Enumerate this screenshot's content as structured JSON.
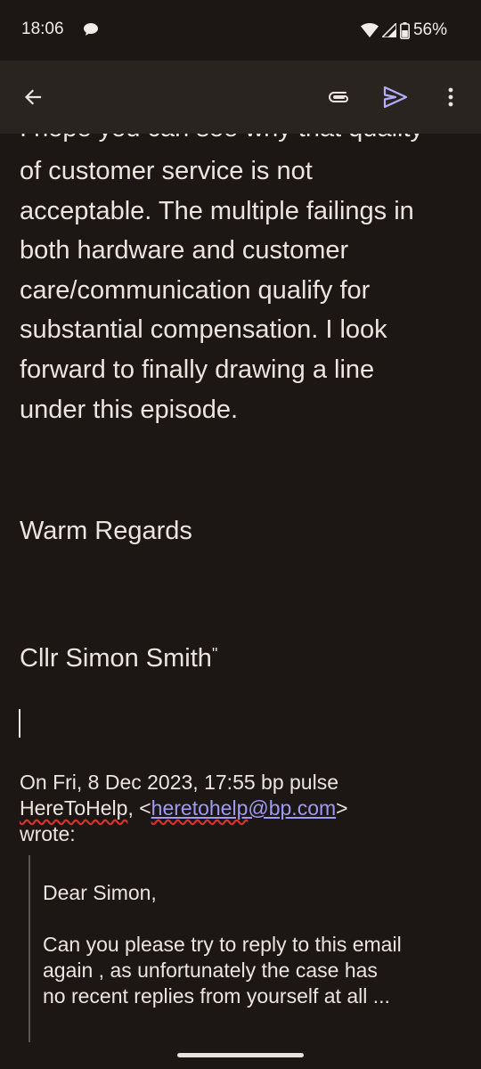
{
  "status_bar": {
    "time": "18:06",
    "battery_percent": "56%",
    "icons": [
      "chat-bubble-icon",
      "wifi-icon",
      "signal-icon",
      "battery-icon"
    ]
  },
  "app_bar": {
    "icons": [
      "back-arrow-icon",
      "attach-icon",
      "send-icon",
      "more-vert-icon"
    ],
    "accent_color": "#b3aefc"
  },
  "body": {
    "clipped_top_line": "I hope you can see why that quality",
    "paragraph_lines": [
      "of customer service is not",
      "acceptable. The multiple failings in",
      "both hardware and customer",
      "care/communication qualify for",
      "substantial compensation. I look",
      "forward to finally drawing a line",
      "under this episode."
    ],
    "regards": "Warm Regards",
    "signature_name": "Cllr Simon Smith",
    "signature_quote_mark": "\""
  },
  "quoted": {
    "header_line1": "On Fri, 8 Dec 2023, 17:55 bp pulse",
    "header_sender": "HereToHelp",
    "header_open": ", <",
    "header_email_user": "heretohelp",
    "header_email_domain": "@bp.com",
    "header_close": ">",
    "header_line3": "wrote:",
    "greeting": "Dear Simon,",
    "message_lines": [
      "Can you please try to reply to this email",
      "again , as unfortunately the case has",
      "no recent replies from yourself at all ..."
    ]
  }
}
